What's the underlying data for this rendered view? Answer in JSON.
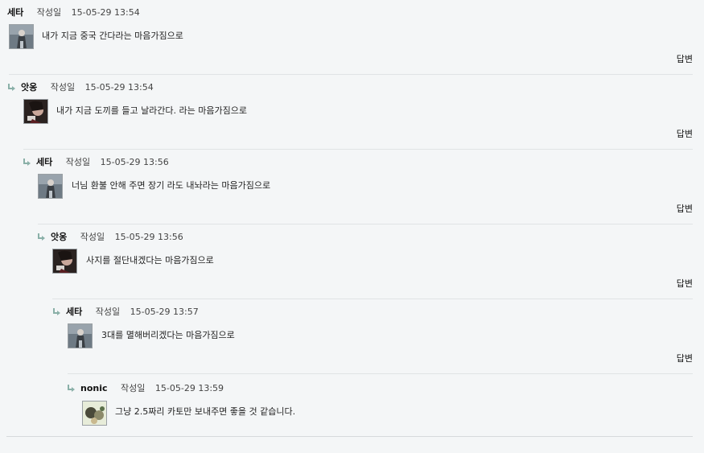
{
  "comments": [
    {
      "author": "세타",
      "written_label": "작성일",
      "date": "15-05-29 13:54",
      "text": "내가 지금 중국 간다라는 마음가짐으로",
      "reply_label": "답변",
      "avatar": "avatar-a"
    },
    {
      "author": "앗옹",
      "written_label": "작성일",
      "date": "15-05-29 13:54",
      "text": "내가 지금 도끼를 들고 날라간다. 라는 마음가짐으로",
      "reply_label": "답변",
      "avatar": "avatar-b"
    },
    {
      "author": "세타",
      "written_label": "작성일",
      "date": "15-05-29 13:56",
      "text": "너님 환불 안해 주면 장기 라도 내놔라는 마음가짐으로",
      "reply_label": "답변",
      "avatar": "avatar-a"
    },
    {
      "author": "앗옹",
      "written_label": "작성일",
      "date": "15-05-29 13:56",
      "text": "사지를 절단내겠다는 마음가짐으로",
      "reply_label": "답변",
      "avatar": "avatar-b"
    },
    {
      "author": "세타",
      "written_label": "작성일",
      "date": "15-05-29 13:57",
      "text": "3대를 멸해버리겠다는 마음가짐으로",
      "reply_label": "답변",
      "avatar": "avatar-a"
    },
    {
      "author": "nonic",
      "written_label": "작성일",
      "date": "15-05-29 13:59",
      "text": "그냥 2.5짜리 카토만 보내주면 좋을 것 같습니다.",
      "reply_label": "",
      "avatar": "avatar-c"
    }
  ],
  "colors": {
    "background": "#f4f6f7",
    "divider": "#e0e3e5",
    "reply_arrow": "#8ab0a8"
  }
}
